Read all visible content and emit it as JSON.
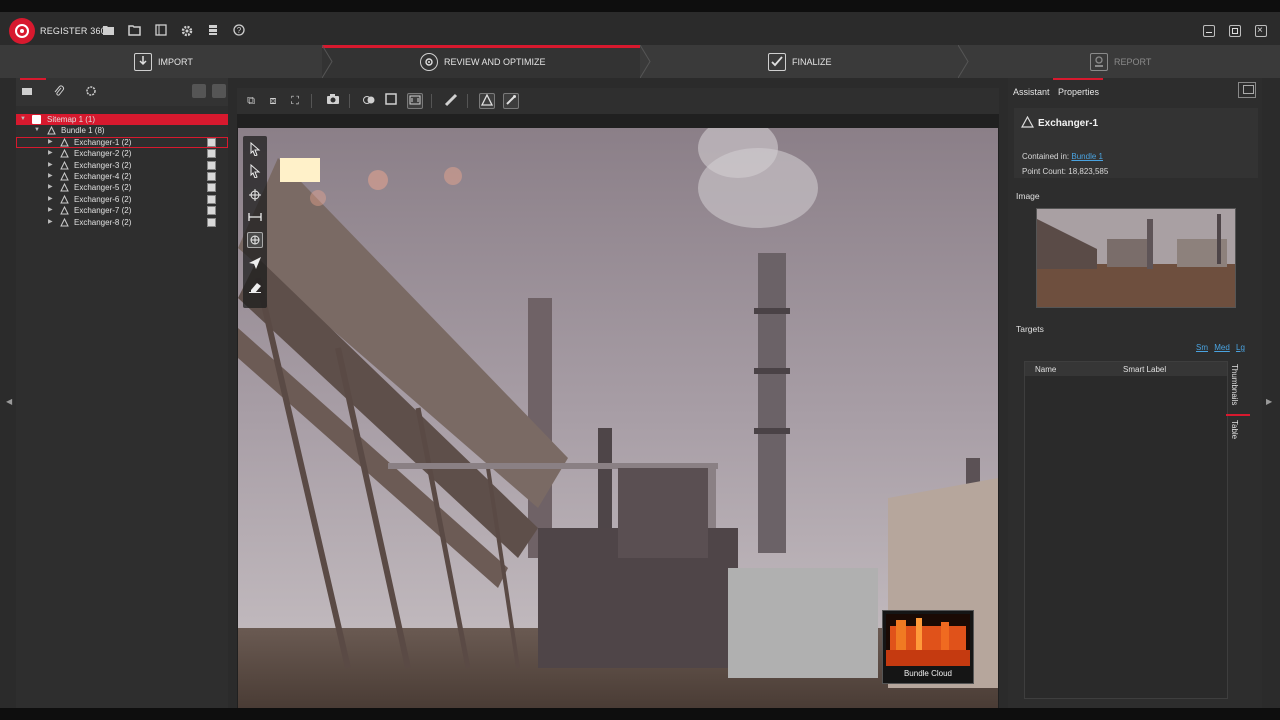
{
  "app": {
    "title": "REGISTER 360",
    "brand_color": "#d7192e"
  },
  "titlebar_icons": [
    "open-folder-icon",
    "folder-icon",
    "book-icon",
    "gear-icon",
    "database-icon",
    "help-icon"
  ],
  "workflow": {
    "steps": [
      {
        "label": "IMPORT",
        "icon": "import-icon",
        "active": false
      },
      {
        "label": "REVIEW AND OPTIMIZE",
        "icon": "review-icon",
        "active": true
      },
      {
        "label": "FINALIZE",
        "icon": "finalize-check-icon",
        "active": false
      },
      {
        "label": "REPORT",
        "icon": "report-icon",
        "active": false,
        "disabled": true
      }
    ]
  },
  "tree": {
    "sitemap": "Sitemap 1 (1)",
    "bundle": "Bundle 1 (8)",
    "items": [
      "Exchanger-1 (2)",
      "Exchanger-2 (2)",
      "Exchanger-3 (2)",
      "Exchanger-4 (2)",
      "Exchanger-5 (2)",
      "Exchanger-6 (2)",
      "Exchanger-7 (2)",
      "Exchanger-8 (2)"
    ]
  },
  "viewer": {
    "overlay_label": "Bundle Cloud"
  },
  "right_panel": {
    "tabs": [
      "Assistant",
      "Properties"
    ],
    "active_tab": "Properties",
    "title": "Exchanger-1",
    "contained_in_label": "Contained in:",
    "contained_in_value": "Bundle 1",
    "point_count_label": "Point Count:",
    "point_count_value": "18,823,585",
    "image_section": "Image",
    "targets_section": "Targets",
    "size_links": [
      "Sm",
      "Med",
      "Lg"
    ],
    "table_headers": [
      "Name",
      "Smart Label"
    ],
    "side_tabs": [
      "Thumbnails",
      "Table"
    ]
  }
}
